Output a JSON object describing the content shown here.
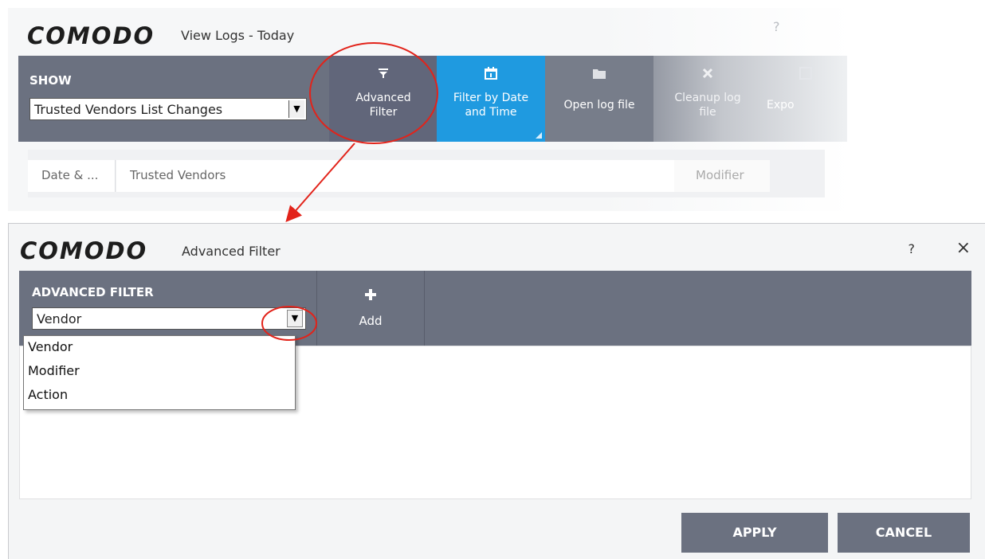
{
  "top_window": {
    "brand": "COMODO",
    "title": "View Logs - Today",
    "help": "?",
    "show_label": "SHOW",
    "show_value": "Trusted Vendors List Changes",
    "toolbar": [
      {
        "label_1": "Advanced",
        "label_2": "Filter",
        "icon": "filter-icon"
      },
      {
        "label_1": "Filter by Date",
        "label_2": "and Time",
        "icon": "calendar-icon"
      },
      {
        "label_1": "Open log file",
        "label_2": "",
        "icon": "folder-icon"
      },
      {
        "label_1": "Cleanup log",
        "label_2": "file",
        "icon": "x-icon"
      },
      {
        "label_1": "Expo",
        "label_2": "",
        "icon": "export-icon"
      }
    ],
    "columns": [
      "Date & ...",
      "Trusted Vendors",
      "Modifier"
    ]
  },
  "dialog": {
    "brand": "COMODO",
    "title": "Advanced Filter",
    "help": "?",
    "close": "×",
    "filter_label": "ADVANCED FILTER",
    "filter_value": "Vendor",
    "add_icon": "plus-icon",
    "add_label": "Add",
    "options": [
      "Vendor",
      "Modifier",
      "Action"
    ],
    "apply_label": "APPLY",
    "cancel_label": "CANCEL"
  },
  "colors": {
    "toolbar": "#6b7180",
    "date_button": "#1f9ae0",
    "annotation": "#e2231a"
  }
}
